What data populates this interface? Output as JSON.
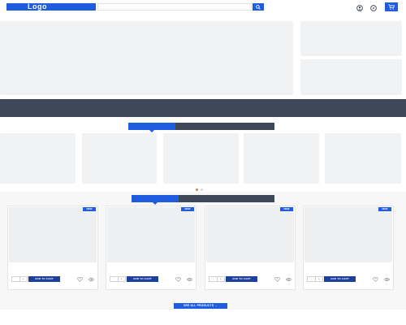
{
  "header": {
    "logo_text": "Logo",
    "search_placeholder": "",
    "icons": [
      "search-icon",
      "user-icon",
      "compass-icon",
      "cart-icon"
    ]
  },
  "colors": {
    "accent": "#1f5ce0",
    "dark": "#3d4858",
    "placeholder": "#f1f2f4",
    "dot_active": "#f07a3a"
  },
  "carousel": {
    "active_index": 0,
    "count": 2
  },
  "products": [
    {
      "badge": "NEW",
      "qty_minus": "-",
      "qty_plus": "+",
      "add_label": "ADD TO CART"
    },
    {
      "badge": "NEW",
      "qty_minus": "-",
      "qty_plus": "+",
      "add_label": "ADD TO CART"
    },
    {
      "badge": "NEW",
      "qty_minus": "-",
      "qty_plus": "+",
      "add_label": "ADD TO CART"
    },
    {
      "badge": "NEW",
      "qty_minus": "-",
      "qty_plus": "+",
      "add_label": "ADD TO CART"
    }
  ],
  "see_all_label": "SEE ALL PRODUCTS →"
}
